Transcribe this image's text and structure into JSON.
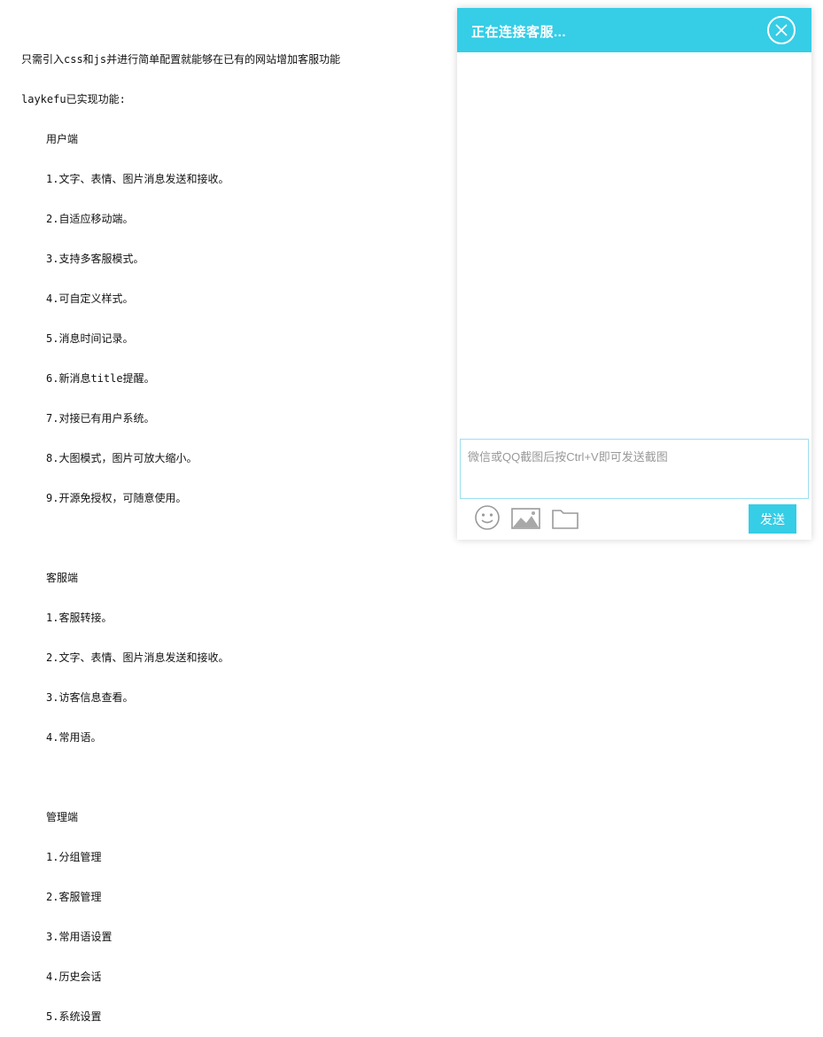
{
  "doc": {
    "intro": "只需引入css和js并进行简单配置就能够在已有的网站增加客服功能",
    "features_title": "laykefu已实现功能:",
    "user_section": "用户端",
    "user_items": [
      "1.文字、表情、图片消息发送和接收。",
      "2.自适应移动端。",
      "3.支持多客服模式。",
      "4.可自定义样式。",
      "5.消息时间记录。",
      "6.新消息title提醒。",
      "7.对接已有用户系统。",
      "8.大图模式，图片可放大缩小。",
      "9.开源免授权，可随意使用。"
    ],
    "agent_section": "客服端",
    "agent_items": [
      "1.客服转接。",
      "2.文字、表情、图片消息发送和接收。",
      "3.访客信息查看。",
      "4.常用语。"
    ],
    "admin_section": "管理端",
    "admin_items": [
      "1.分组管理",
      "2.客服管理",
      "3.常用语设置",
      "4.历史会话",
      "5.系统设置"
    ]
  },
  "chat": {
    "title": "正在连接客服...",
    "input_placeholder": "微信或QQ截图后按Ctrl+V即可发送截图",
    "send_label": "发送",
    "accent_color": "#36cde6",
    "icons": [
      "emoji-icon",
      "image-icon",
      "folder-icon",
      "close-icon"
    ]
  }
}
